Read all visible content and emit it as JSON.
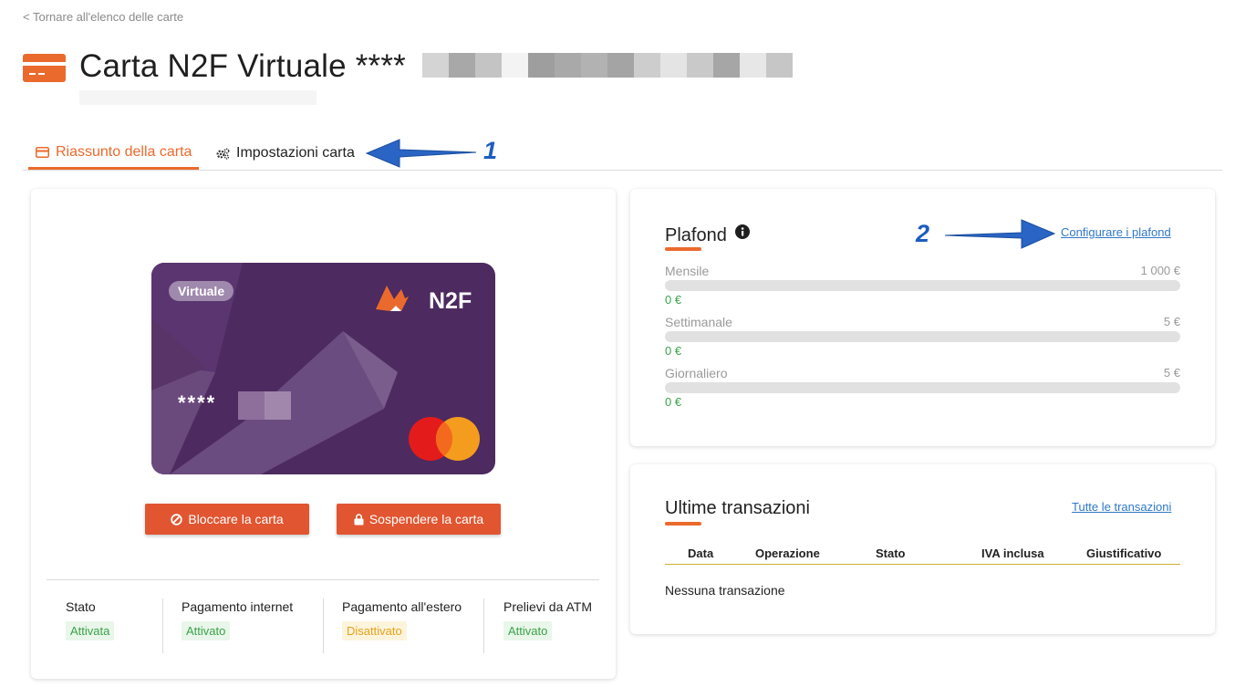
{
  "nav": {
    "back_label": "< Tornare all'elenco delle carte"
  },
  "header": {
    "title": "Carta N2F Virtuale ****",
    "icon": "credit-card-icon",
    "accent": "#ea6a2d"
  },
  "tabs": [
    {
      "label": "Riassunto della carta",
      "icon": "credit-card-icon",
      "active": true
    },
    {
      "label": "Impostazioni carta",
      "icon": "gears-icon",
      "active": false
    }
  ],
  "annotations": [
    {
      "number": "1"
    },
    {
      "number": "2"
    }
  ],
  "card": {
    "badge": "Virtuale",
    "brand": "N2F",
    "number_masked": "****",
    "network": "mastercard-logo"
  },
  "actions": {
    "block_label": "Bloccare la carta",
    "suspend_label": "Sospendere la carta",
    "color": "#e15530"
  },
  "status": [
    {
      "label": "Stato",
      "value": "Attivata",
      "tone": "green"
    },
    {
      "label": "Pagamento internet",
      "value": "Attivato",
      "tone": "green"
    },
    {
      "label": "Pagamento all'estero",
      "value": "Disattivato",
      "tone": "yellow"
    },
    {
      "label": "Prelievi da ATM",
      "value": "Attivato",
      "tone": "green"
    }
  ],
  "plafond": {
    "title": "Plafond",
    "configure_link": "Configurare i plafond",
    "limits": [
      {
        "name": "Mensile",
        "max": "1 000 €",
        "used": "0 €",
        "used_fraction": 0
      },
      {
        "name": "Settimanale",
        "max": "5 €",
        "used": "0 €",
        "used_fraction": 0
      },
      {
        "name": "Giornaliero",
        "max": "5 €",
        "used": "0 €",
        "used_fraction": 0
      }
    ]
  },
  "transactions": {
    "title": "Ultime transazioni",
    "all_link": "Tutte le transazioni",
    "columns": [
      "Data",
      "Operazione",
      "Stato",
      "IVA inclusa",
      "Giustificativo"
    ],
    "empty_message": "Nessuna transazione"
  }
}
